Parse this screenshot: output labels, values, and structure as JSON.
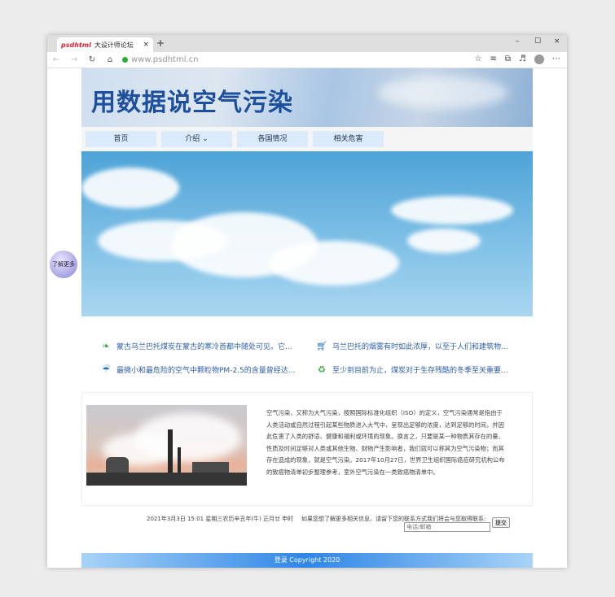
{
  "browser": {
    "tab_favicon": "psdhtml",
    "tab_title": "大设计师论坛",
    "tab_close": "×",
    "new_tab": "+",
    "url": "www.psdhtml.cn",
    "win_minimize": "–",
    "win_maximize": "☐",
    "win_close": "×"
  },
  "banner": {
    "title": "用数据说空气污染"
  },
  "nav": {
    "items": [
      {
        "label": "首页"
      },
      {
        "label": "介绍 ⌄"
      },
      {
        "label": "各国情况"
      },
      {
        "label": "相关危害"
      }
    ]
  },
  "side_badge": {
    "label": "了解更多"
  },
  "news": [
    {
      "icon": "leaf-icon",
      "text": "蒙古乌兰巴托煤炭在蒙古的寒冷首都中随处可见。它..."
    },
    {
      "icon": "cart-icon",
      "text": "乌兰巴托的烟雾有时如此浓厚，以至于人们和建筑物..."
    },
    {
      "icon": "weather-icon",
      "text": "最微小和最危险的空气中颗粒物PM-2.5的含量曾经达..."
    },
    {
      "icon": "recycle-icon",
      "text": "至少到目前为止，煤炭对于生存残酷的冬季至关重要..."
    }
  ],
  "article": {
    "text": "空气污染，又称为大气污染，按照国际标准化组织（ISO）的定义，空气污染通常是指由于人类活动或自然过程引起某些物质进入大气中，呈现出足够的浓度，达到足够的时间，并因此危害了人类的舒适、健康和福利或环境的现象。换言之，只要是某一种物质其存在的量、性质及时间足够对人类或其他生物、财物产生影响者，我们就可以称其为空气污染物；而其存在造成的现象，就是空气污染。2017年10月27日，世界卫生组织国际癌症研究机构公布的致癌物清单初步整理参考，室外空气污染在一类致癌物清单中。"
  },
  "footer": {
    "date": "2021年3月3日 15:01 星期三农历辛丑年(牛) 正月廿 申时",
    "contact_prompt": "如果您想了解更多相关信息，请留下您的联系方式我们将会与您取得联系:",
    "input_placeholder": "电话/邮箱",
    "submit_label": "提交",
    "login_link": "登录",
    "copyright": " Copyright 2020"
  }
}
